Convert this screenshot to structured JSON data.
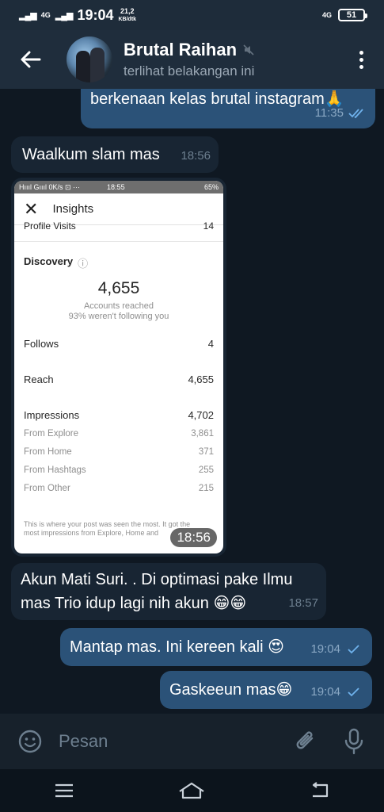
{
  "status_bar": {
    "net_type": "4G",
    "time": "19:04",
    "speed_value": "21,2",
    "speed_unit": "KB/dtk",
    "right_net": "4G",
    "battery": "51"
  },
  "header": {
    "contact_name": "Brutal Raihan",
    "last_seen": "terlihat belakangan ini"
  },
  "messages": [
    {
      "text": "berkenaan kelas brutal instagram🙏",
      "time": "11:35"
    },
    {
      "text": "Waalkum slam mas",
      "time": "18:56"
    },
    {
      "image_time": "18:56"
    },
    {
      "line1": "Akun Mati Suri. . Di optimasi pake Ilmu",
      "line2": "mas Trio idup lagi nih akun 😁😁",
      "time": "18:57"
    },
    {
      "text": "Mantap mas. Ini kereen kali 😍",
      "time": "19:04"
    },
    {
      "text": "Gaskeeun mas😁",
      "time": "19:04"
    }
  ],
  "screenshot": {
    "status_left": "Hıııl Gıııl 0K/s ⊡ ···",
    "status_time": "18:55",
    "status_battery": "65%",
    "title": "Insights",
    "profile_visits_label": "Profile Visits",
    "profile_visits_value": "14",
    "discovery_label": "Discovery",
    "accounts_reached_value": "4,655",
    "accounts_reached_label": "Accounts reached",
    "not_following": "93% weren't following you",
    "follows_label": "Follows",
    "follows_value": "4",
    "reach_label": "Reach",
    "reach_value": "4,655",
    "impressions_label": "Impressions",
    "impressions_value": "4,702",
    "sources": [
      {
        "label": "From Explore",
        "value": "3,861"
      },
      {
        "label": "From Home",
        "value": "371"
      },
      {
        "label": "From Hashtags",
        "value": "255"
      },
      {
        "label": "From Other",
        "value": "215"
      }
    ],
    "footer_line1": "This is where your post was seen the most. It got the",
    "footer_line2": "most impressions from Explore, Home and"
  },
  "input": {
    "placeholder": "Pesan"
  },
  "colors": {
    "outgoing_bubble": "#2b5278",
    "incoming_bubble": "#182533",
    "chat_background": "#0f1822",
    "check_color": "#6fb2ec"
  }
}
